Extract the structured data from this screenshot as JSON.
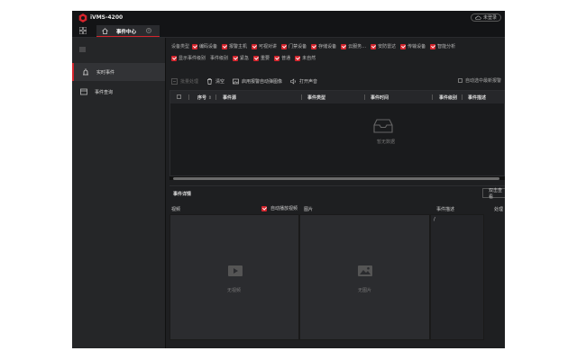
{
  "window": {
    "app_title": "iVMS-4200",
    "cloud_label": "未登录"
  },
  "tabs": [
    {
      "label": "事件中心"
    }
  ],
  "sidebar": {
    "items": [
      {
        "label": "实时事件",
        "active": true
      },
      {
        "label": "事件查询",
        "active": false
      }
    ]
  },
  "filters": {
    "row1_label": "设备类型",
    "row1_items": [
      "编码设备",
      "报警主机",
      "可视对讲",
      "门禁设备",
      "存储设备",
      "云服务…",
      "安防雷达",
      "传输设备",
      "智能分析"
    ],
    "row2_items": [
      "显示事件级别",
      "事件级别",
      "紧急",
      "重要",
      "普通",
      "未自然"
    ]
  },
  "toolbar": {
    "handle": "批量处理",
    "clear": "清空",
    "popup_image": "启用报警自动弹图像",
    "sound": "打开声音",
    "auto_select": "自动选中最新报警"
  },
  "table": {
    "columns": [
      "序号",
      "事件源",
      "事件类型",
      "事件时间",
      "事件级别",
      "事件描述"
    ],
    "empty_text": "暂无数据"
  },
  "detail": {
    "title": "事件详情",
    "button": "双击查看",
    "video_label": "视频",
    "autoplay_label": "自动播放视频",
    "picture_label": "图片",
    "desc_label": "事件描述",
    "desc_value": "/",
    "handle_label": "处理",
    "no_video": "无视频",
    "no_picture": "无图片"
  },
  "colors": {
    "accent": "#d4242c",
    "background": "#1e1f21",
    "sidebar": "#252628"
  }
}
